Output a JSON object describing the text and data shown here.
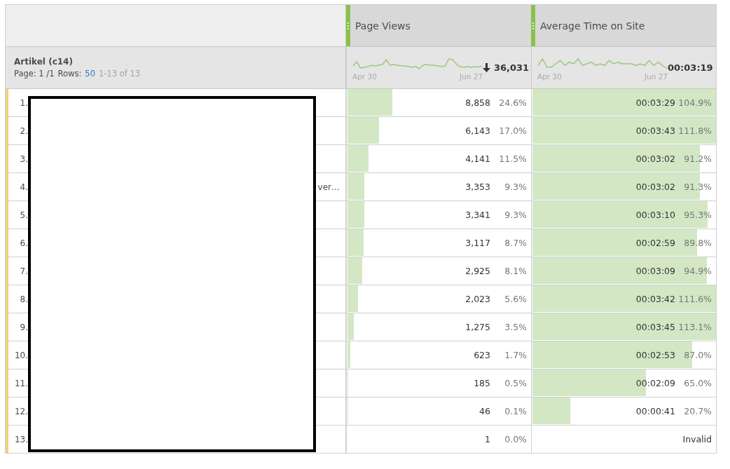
{
  "table": {
    "columns": [
      {},
      {
        "label": "Page Views"
      },
      {
        "label": "Average Time on Site"
      }
    ],
    "summary": {
      "dimension": "Artikel (c14)",
      "page_label": "Page: 1 /1",
      "rows_label": "Rows:",
      "rows_value": "50",
      "range": "1-13 of 13",
      "page_views": {
        "start": "Apr 30",
        "end": "Jun 27",
        "total": "36,031"
      },
      "avg_time": {
        "start": "Apr 30",
        "end": "Jun 27",
        "total": "00:03:19"
      }
    },
    "rows": [
      {
        "index": "1.",
        "views": {
          "value": "8,858",
          "pct": "24.6%",
          "level": 0.246
        },
        "time": {
          "value": "00:03:29",
          "pct": "104.9%",
          "level": 1
        }
      },
      {
        "index": "2.",
        "views": {
          "value": "6,143",
          "pct": "17.0%",
          "level": 0.17
        },
        "time": {
          "value": "00:03:43",
          "pct": "111.8%",
          "level": 1
        }
      },
      {
        "index": "3.",
        "views": {
          "value": "4,141",
          "pct": "11.5%",
          "level": 0.115
        },
        "time": {
          "value": "00:03:02",
          "pct": "91.2%",
          "level": 0.912
        }
      },
      {
        "index": "4.",
        "label": "ver…",
        "views": {
          "value": "3,353",
          "pct": "9.3%",
          "level": 0.093
        },
        "time": {
          "value": "00:03:02",
          "pct": "91.3%",
          "level": 0.913
        }
      },
      {
        "index": "5.",
        "views": {
          "value": "3,341",
          "pct": "9.3%",
          "level": 0.093
        },
        "time": {
          "value": "00:03:10",
          "pct": "95.3%",
          "level": 0.953
        }
      },
      {
        "index": "6.",
        "views": {
          "value": "3,117",
          "pct": "8.7%",
          "level": 0.087
        },
        "time": {
          "value": "00:02:59",
          "pct": "89.8%",
          "level": 0.898
        }
      },
      {
        "index": "7.",
        "views": {
          "value": "2,925",
          "pct": "8.1%",
          "level": 0.081
        },
        "time": {
          "value": "00:03:09",
          "pct": "94.9%",
          "level": 0.949
        }
      },
      {
        "index": "8.",
        "views": {
          "value": "2,023",
          "pct": "5.6%",
          "level": 0.056
        },
        "time": {
          "value": "00:03:42",
          "pct": "111.6%",
          "level": 1
        }
      },
      {
        "index": "9.",
        "views": {
          "value": "1,275",
          "pct": "3.5%",
          "level": 0.035
        },
        "time": {
          "value": "00:03:45",
          "pct": "113.1%",
          "level": 1
        }
      },
      {
        "index": "10.",
        "views": {
          "value": "623",
          "pct": "1.7%",
          "level": 0.017
        },
        "time": {
          "value": "00:02:53",
          "pct": "87.0%",
          "level": 0.87
        }
      },
      {
        "index": "11.",
        "views": {
          "value": "185",
          "pct": "0.5%",
          "level": 0.005
        },
        "time": {
          "value": "00:02:09",
          "pct": "65.0%",
          "level": 0.62
        }
      },
      {
        "index": "12.",
        "views": {
          "value": "46",
          "pct": "0.1%",
          "level": 0.001
        },
        "time": {
          "value": "00:00:41",
          "pct": "20.7%",
          "level": 0.207
        }
      },
      {
        "index": "13.",
        "views": {
          "value": "1",
          "pct": "0.0%"
        },
        "time": {
          "value": "Invalid"
        }
      }
    ]
  }
}
